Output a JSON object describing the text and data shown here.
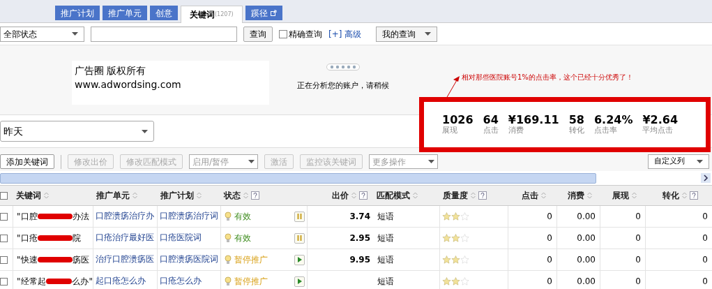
{
  "tabs": [
    {
      "label": "推广计划",
      "selected": false
    },
    {
      "label": "推广单元",
      "selected": false
    },
    {
      "label": "创意",
      "selected": false
    },
    {
      "label": "关键词",
      "count": "(1207)",
      "selected": true
    },
    {
      "label": "蹊径",
      "external": true,
      "selected": false
    }
  ],
  "filter": {
    "status_select": "全部状态",
    "query_button": "查询",
    "exact_checkbox": {
      "label": "精确查询",
      "checked": false
    },
    "advanced_link": "[+] 高级",
    "my_query": "我的查询"
  },
  "banner": {
    "line1": "广告圈 版权所有",
    "line2": "www.adwordsing.com",
    "loading": "正在分析您的账户，请稍候"
  },
  "annotation": "相对那些医院账号1%的点击率，这个已经十分优秀了！",
  "date_select": "昨天",
  "stats": [
    {
      "value": "1026",
      "label": "展现"
    },
    {
      "value": "64",
      "label": "点击"
    },
    {
      "value": "¥169.11",
      "label": "消费"
    },
    {
      "value": "58",
      "label": "转化"
    },
    {
      "value": "6.24%",
      "label": "点击率"
    },
    {
      "value": "¥2.64",
      "label": "平均点击"
    }
  ],
  "toolbar": [
    {
      "label": "添加关键词",
      "kind": "button",
      "disabled": false
    },
    {
      "label": "修改出价",
      "kind": "button",
      "disabled": true
    },
    {
      "label": "修改匹配模式",
      "kind": "button",
      "disabled": true
    },
    {
      "label": "启用/暂停",
      "kind": "select",
      "disabled": true
    },
    {
      "label": "激活",
      "kind": "button",
      "disabled": true
    },
    {
      "label": "监控该关键词",
      "kind": "button",
      "disabled": true
    },
    {
      "label": "更多操作",
      "kind": "select",
      "disabled": true
    }
  ],
  "custom_columns": "自定义列",
  "table": {
    "select_all_checked": false,
    "columns": [
      {
        "label": "关键词",
        "help": false
      },
      {
        "label": "推广单元",
        "help": false
      },
      {
        "label": "推广计划",
        "help": false
      },
      {
        "label": "状态",
        "help": true
      },
      {
        "label": "出价",
        "help": true
      },
      {
        "label": "匹配模式",
        "help": false
      },
      {
        "label": "质量度",
        "help": true
      },
      {
        "label": "点击",
        "help": false
      },
      {
        "label": "消费",
        "help": false
      },
      {
        "label": "展现",
        "help": false
      },
      {
        "label": "转化",
        "help": true
      }
    ],
    "rows": [
      {
        "checked": false,
        "keyword_start": "\"口腔",
        "keyword_end": "办法",
        "unit": "口腔溃疡治疗办",
        "plan": "口腔溃疡治疗词",
        "status": "有效",
        "kind": "active",
        "bid": "3.74",
        "match": "短语",
        "stars": 2,
        "clicks": "0",
        "spend": "0.00",
        "impressions": "0",
        "conversions": "0"
      },
      {
        "checked": false,
        "keyword_start": "\"口疮",
        "keyword_end": "院",
        "unit": "口疮治疗最好医",
        "plan": "口疮医院词",
        "status": "有效",
        "kind": "active",
        "bid": "2.95",
        "match": "短语",
        "stars": 2,
        "clicks": "0",
        "spend": "0.00",
        "impressions": "0",
        "conversions": "0"
      },
      {
        "checked": false,
        "keyword_start": "\"快速",
        "keyword_end": "疡医",
        "unit": "治疗口腔溃疡医",
        "plan": "口腔溃疡医院词",
        "status": "暂停推广",
        "kind": "paused",
        "bid": "9.95",
        "match": "短语",
        "stars": 2,
        "clicks": "0",
        "spend": "0.00",
        "impressions": "0",
        "conversions": "0"
      },
      {
        "checked": false,
        "keyword_start": "\"经常起",
        "keyword_end": "么办\"",
        "unit": "起口疮怎么办",
        "plan": "口疮怎么办",
        "status": "暂停推广",
        "kind": "paused",
        "match": "短语",
        "stars": 2,
        "clicks": "0",
        "spend": "0.00",
        "impressions": "0",
        "conversions": "0"
      }
    ]
  }
}
